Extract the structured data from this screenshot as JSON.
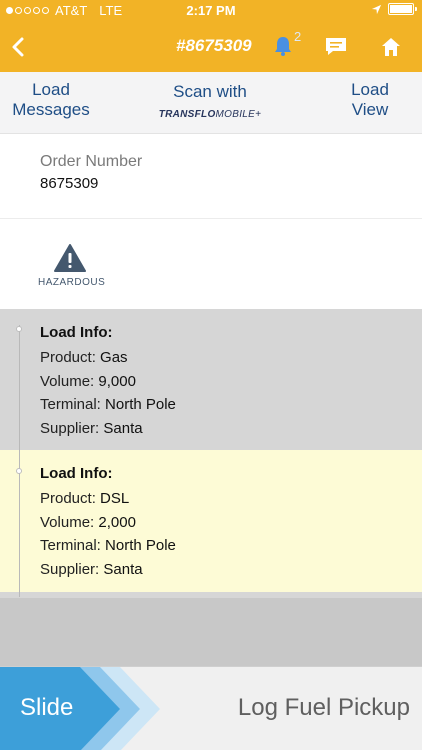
{
  "status_bar": {
    "carrier": "AT&T",
    "network": "LTE",
    "time": "2:17 PM"
  },
  "nav": {
    "order_title": "#8675309",
    "notification_count": "2"
  },
  "toolbar": {
    "load_messages": [
      "Load",
      "Messages"
    ],
    "scan_with": "Scan with",
    "transflo_brand": "TRANSFLO",
    "transflo_suffix": "MOBILE+",
    "load_view": [
      "Load",
      "View"
    ]
  },
  "order": {
    "label": "Order Number",
    "value": "8675309"
  },
  "hazard": {
    "label": "HAZARDOUS"
  },
  "loads": [
    {
      "title": "Load Info:",
      "product_label": "Product:",
      "product": "Gas",
      "volume_label": "Volume:",
      "volume": "9,000",
      "terminal_label": "Terminal:",
      "terminal": "North Pole",
      "supplier_label": "Supplier:",
      "supplier": "Santa"
    },
    {
      "title": "Load Info:",
      "product_label": "Product:",
      "product": "DSL",
      "volume_label": "Volume:",
      "volume": "2,000",
      "terminal_label": "Terminal:",
      "terminal": "North Pole",
      "supplier_label": "Supplier:",
      "supplier": "Santa"
    }
  ],
  "slide": {
    "slide_label": "Slide",
    "action_label": "Log Fuel Pickup"
  },
  "colors": {
    "brand_yellow": "#f2b326",
    "toolbar_text": "#1f4e86",
    "slide_blue": "#3d9fd9",
    "hazard_icon": "#44586e"
  },
  "icons": {
    "back": "chevron-left-icon",
    "bell": "bell-icon",
    "chat": "chat-icon",
    "home": "home-icon",
    "hazard": "warning-triangle-icon",
    "location": "location-arrow-icon",
    "battery": "battery-icon"
  }
}
